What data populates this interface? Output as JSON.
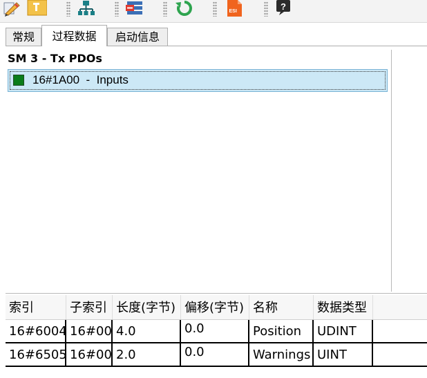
{
  "toolbar": {
    "icons": [
      "edit-pencil-icon",
      "yellow-box-icon",
      "network-tree-icon",
      "list-remove-icon",
      "refresh-icon",
      "esi-file-icon",
      "help-question-icon"
    ],
    "esi_label": "ESI",
    "help_label": "?"
  },
  "tabs": [
    {
      "label": "常规",
      "active": false
    },
    {
      "label": "过程数据",
      "active": true
    },
    {
      "label": "启动信息",
      "active": false
    }
  ],
  "sync_manager": {
    "title": "SM 3 - Tx PDOs",
    "pdos": [
      {
        "label": "16#1A00  -  Inputs",
        "checked": true,
        "selected": true
      }
    ]
  },
  "table": {
    "columns": [
      "索引",
      "子索引",
      "长度(字节)",
      "偏移(字节)",
      "名称",
      "数据类型"
    ],
    "rows": [
      [
        "16#6004",
        "16#00",
        "4.0",
        "0.0",
        "Position",
        "UDINT"
      ],
      [
        "16#6505",
        "16#00",
        "2.0",
        "0.0",
        "Warnings",
        "UINT"
      ]
    ]
  },
  "colors": {
    "selection_bg": "#cce8f6",
    "checkbox_green": "#0a7d1a",
    "esi_orange": "#f0641e",
    "refresh_green": "#2ea44f"
  }
}
